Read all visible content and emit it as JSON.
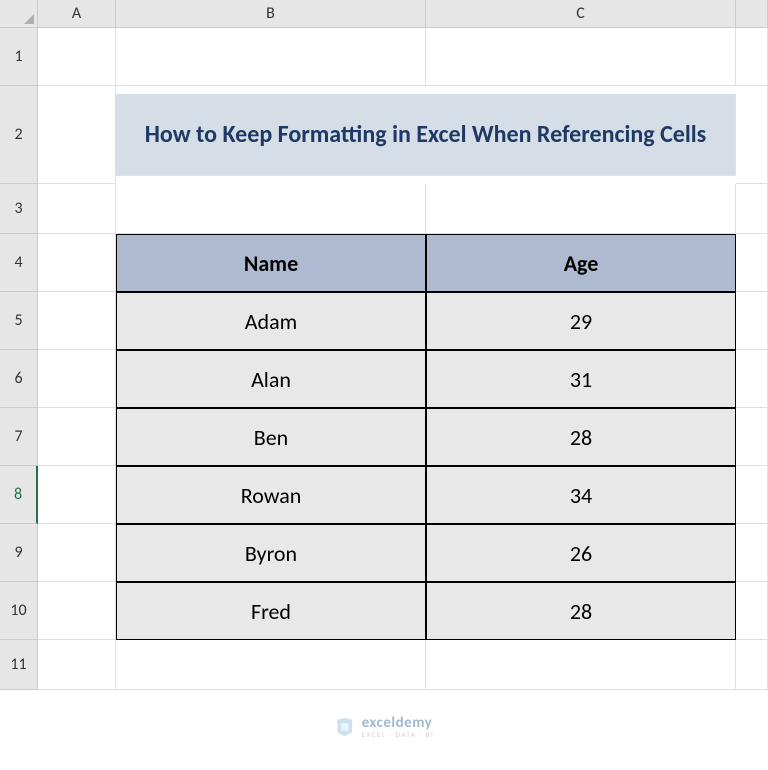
{
  "columns": [
    "A",
    "B",
    "C"
  ],
  "rows": [
    "1",
    "2",
    "3",
    "4",
    "5",
    "6",
    "7",
    "8",
    "9",
    "10",
    "11"
  ],
  "selectedRow": "8",
  "title": "How to Keep Formatting in Excel When Referencing Cells",
  "table": {
    "headers": [
      "Name",
      "Age"
    ],
    "data": [
      {
        "name": "Adam",
        "age": "29"
      },
      {
        "name": "Alan",
        "age": "31"
      },
      {
        "name": "Ben",
        "age": "28"
      },
      {
        "name": "Rowan",
        "age": "34"
      },
      {
        "name": "Byron",
        "age": "26"
      },
      {
        "name": "Fred",
        "age": "28"
      }
    ]
  },
  "watermark": {
    "main": "exceldemy",
    "sub": "EXCEL · DATA · BI"
  }
}
